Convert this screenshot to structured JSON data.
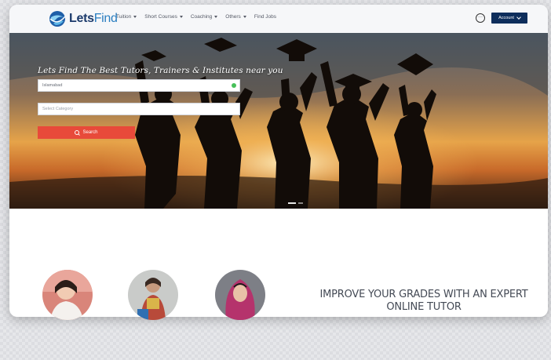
{
  "brand": {
    "name_part1": "Lets",
    "name_part2": "Find"
  },
  "nav": {
    "items": [
      {
        "label": "Tuition",
        "has_dropdown": true
      },
      {
        "label": "Short Courses",
        "has_dropdown": true
      },
      {
        "label": "Coaching",
        "has_dropdown": true
      },
      {
        "label": "Others",
        "has_dropdown": true
      },
      {
        "label": "Find Jobs",
        "has_dropdown": false
      }
    ],
    "chat_icon": "chat-bubble-icon",
    "account_label": "Account"
  },
  "hero": {
    "tagline": "Lets Find The Best Tutors, Trainers & Institutes near you",
    "location_value": "Islamabad",
    "category_placeholder": "Select Category",
    "search_label": "Search"
  },
  "promo": {
    "headline_line1": "IMPROVE YOUR GRADES WITH AN EXPERT",
    "headline_line2": "ONLINE TUTOR"
  },
  "colors": {
    "nav_bg": "#f6f7f9",
    "account_bg": "#0e2e5c",
    "search_button": "#e84a3a",
    "location_ok": "#47c05a"
  }
}
